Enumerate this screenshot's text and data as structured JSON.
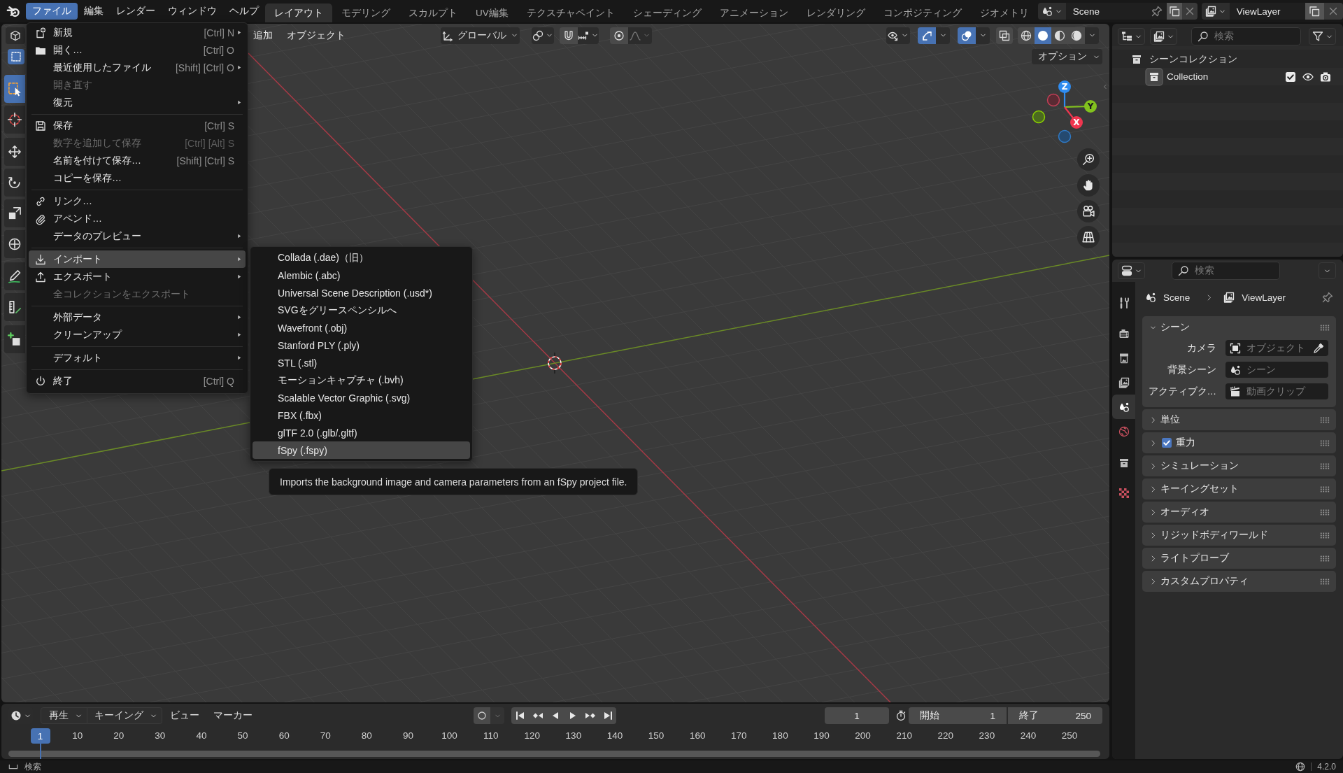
{
  "topbar": {
    "menus": [
      {
        "label": "ファイル",
        "selected": true
      },
      {
        "label": "編集",
        "selected": false
      },
      {
        "label": "レンダー",
        "selected": false
      },
      {
        "label": "ウィンドウ",
        "selected": false
      },
      {
        "label": "ヘルプ",
        "selected": false
      }
    ],
    "workspaces": [
      {
        "label": "レイアウト",
        "selected": true
      },
      {
        "label": "モデリング",
        "selected": false
      },
      {
        "label": "スカルプト",
        "selected": false
      },
      {
        "label": "UV編集",
        "selected": false
      },
      {
        "label": "テクスチャペイント",
        "selected": false
      },
      {
        "label": "シェーディング",
        "selected": false
      },
      {
        "label": "アニメーション",
        "selected": false
      },
      {
        "label": "レンダリング",
        "selected": false
      },
      {
        "label": "コンポジティング",
        "selected": false
      },
      {
        "label": "ジオメトリ",
        "selected": false
      }
    ],
    "scene": {
      "name": "Scene"
    },
    "view_layer": {
      "name": "ViewLayer"
    }
  },
  "file_menu": {
    "sections": [
      [
        {
          "label": "新規",
          "shortcut": "[Ctrl] N",
          "submenu": true,
          "disabled": false,
          "selected": false
        },
        {
          "label": "開く…",
          "shortcut": "[Ctrl] O",
          "submenu": false,
          "disabled": false,
          "selected": false
        },
        {
          "label": "最近使用したファイル",
          "shortcut": "[Shift] [Ctrl] O",
          "submenu": true,
          "disabled": false,
          "selected": false
        },
        {
          "label": "開き直す",
          "submenu": false,
          "disabled": true,
          "selected": false
        },
        {
          "label": "復元",
          "submenu": true,
          "disabled": false,
          "selected": false
        }
      ],
      [
        {
          "label": "保存",
          "shortcut": "[Ctrl] S",
          "submenu": false,
          "disabled": false,
          "selected": false
        },
        {
          "label": "数字を追加して保存",
          "shortcut": "[Ctrl] [Alt] S",
          "submenu": false,
          "disabled": true,
          "selected": false
        },
        {
          "label": "名前を付けて保存…",
          "shortcut": "[Shift] [Ctrl] S",
          "submenu": false,
          "disabled": false,
          "selected": false
        },
        {
          "label": "コピーを保存…",
          "submenu": false,
          "disabled": false,
          "selected": false
        }
      ],
      [
        {
          "label": "リンク…",
          "submenu": false,
          "disabled": false,
          "selected": false
        },
        {
          "label": "アペンド…",
          "submenu": false,
          "disabled": false,
          "selected": false
        },
        {
          "label": "データのプレビュー",
          "submenu": true,
          "disabled": false,
          "selected": false
        }
      ],
      [
        {
          "label": "インポート",
          "submenu": true,
          "disabled": false,
          "selected": true
        },
        {
          "label": "エクスポート",
          "submenu": true,
          "disabled": false,
          "selected": false
        },
        {
          "label": "全コレクションをエクスポート",
          "submenu": false,
          "disabled": true,
          "selected": false
        }
      ],
      [
        {
          "label": "外部データ",
          "submenu": true,
          "disabled": false,
          "selected": false
        },
        {
          "label": "クリーンアップ",
          "submenu": true,
          "disabled": false,
          "selected": false
        }
      ],
      [
        {
          "label": "デフォルト",
          "submenu": true,
          "disabled": false,
          "selected": false
        }
      ],
      [
        {
          "label": "終了",
          "shortcut": "[Ctrl] Q",
          "submenu": false,
          "disabled": false,
          "selected": false
        }
      ]
    ]
  },
  "import_menu": {
    "items": [
      {
        "label": "Collada (.dae)（旧）",
        "selected": false
      },
      {
        "label": "Alembic (.abc)",
        "selected": false
      },
      {
        "label": "Universal Scene Description (.usd*)",
        "selected": false
      },
      {
        "label": "SVGをグリースペンシルへ",
        "selected": false
      },
      {
        "label": "Wavefront (.obj)",
        "selected": false
      },
      {
        "label": "Stanford PLY (.ply)",
        "selected": false
      },
      {
        "label": "STL (.stl)",
        "selected": false
      },
      {
        "label": "モーションキャプチャ (.bvh)",
        "selected": false
      },
      {
        "label": "Scalable Vector Graphic (.svg)",
        "selected": false
      },
      {
        "label": "FBX (.fbx)",
        "selected": false
      },
      {
        "label": "glTF 2.0 (.glb/.gltf)",
        "selected": false
      },
      {
        "label": "fSpy (.fspy)",
        "selected": true
      }
    ]
  },
  "tooltip": {
    "text": "Imports the background image and camera parameters from an fSpy project file."
  },
  "viewport": {
    "header": {
      "menus": [
        {
          "label": "追加"
        },
        {
          "label": "オブジェクト"
        }
      ],
      "orientation": "グローバル",
      "snap": {
        "on": false
      },
      "proportional": {
        "on": false
      },
      "gizmos": {
        "on": true
      },
      "overlays": {
        "on": true
      },
      "xray": {
        "on": false
      },
      "shading": [
        {
          "selected": false
        },
        {
          "selected": true
        },
        {
          "selected": false
        },
        {
          "selected": false
        }
      ]
    },
    "select_modes": [
      {
        "selected": true
      }
    ],
    "options": "オプション",
    "toolbar": [
      {
        "selected": true
      },
      {
        "selected": false
      },
      {
        "selected": false
      },
      {
        "selected": false
      },
      {
        "selected": false
      },
      {
        "selected": false
      },
      {
        "selected": false
      },
      {
        "selected": false
      },
      {
        "selected": false
      }
    ],
    "gizmo_axes": [
      {
        "label": "Z"
      },
      {
        "label": "Y"
      },
      {
        "label": "X"
      }
    ]
  },
  "outliner": {
    "search": {
      "placeholder": "検索"
    },
    "tree": [
      {
        "label": "シーンコレクション",
        "active": false,
        "children": [
          {
            "label": "Collection",
            "active": true,
            "checked": true,
            "visible": true,
            "renderable": true
          }
        ]
      }
    ]
  },
  "properties": {
    "search": {
      "placeholder": "検索"
    },
    "tabs": [
      {
        "selected": false
      },
      {
        "selected": false
      },
      {
        "selected": false
      },
      {
        "selected": false
      },
      {
        "selected": true
      },
      {
        "selected": false
      },
      {
        "selected": false
      },
      {
        "selected": false
      }
    ],
    "breadcrumb": [
      {
        "label": "Scene"
      },
      {
        "label": "ViewLayer"
      }
    ],
    "panels": [
      {
        "title": "シーン",
        "expanded": true,
        "kind": "plain",
        "fields": [
          {
            "label": "カメラ",
            "placeholder": "オブジェクト",
            "eyedropper": true
          },
          {
            "label": "背景シーン",
            "placeholder": "シーン",
            "eyedropper": false
          },
          {
            "label": "アクティブク…",
            "placeholder": "動画クリップ",
            "eyedropper": false
          }
        ]
      },
      {
        "title": "単位",
        "expanded": false,
        "kind": "plain"
      },
      {
        "title": "重力",
        "expanded": false,
        "kind": "toggle",
        "checked": true
      },
      {
        "title": "シミュレーション",
        "expanded": false,
        "kind": "plain"
      },
      {
        "title": "キーイングセット",
        "expanded": false,
        "kind": "plain"
      },
      {
        "title": "オーディオ",
        "expanded": false,
        "kind": "plain"
      },
      {
        "title": "リジッドボディワールド",
        "expanded": false,
        "kind": "plain"
      },
      {
        "title": "ライトプローブ",
        "expanded": false,
        "kind": "plain"
      },
      {
        "title": "カスタムプロパティ",
        "expanded": false,
        "kind": "plain"
      }
    ]
  },
  "timeline": {
    "menus": [
      {
        "label": "再生",
        "kind": "dropdown"
      },
      {
        "label": "キーイング",
        "kind": "dropdown"
      },
      {
        "label": "ビュー",
        "kind": "menu"
      },
      {
        "label": "マーカー",
        "kind": "menu"
      }
    ],
    "auto_keying": {
      "on": false
    },
    "current_frame": "1",
    "start": {
      "label": "開始",
      "value": "1"
    },
    "end": {
      "label": "終了",
      "value": "250"
    },
    "playhead": {
      "label": "1",
      "level": 0
    },
    "ruler": [
      "10",
      "20",
      "30",
      "40",
      "50",
      "60",
      "70",
      "80",
      "90",
      "100",
      "110",
      "120",
      "130",
      "140",
      "150",
      "160",
      "170",
      "180",
      "190",
      "200",
      "210",
      "220",
      "230",
      "240",
      "250"
    ]
  },
  "status_bar": {
    "hint": "検索",
    "version": "4.2.0"
  }
}
